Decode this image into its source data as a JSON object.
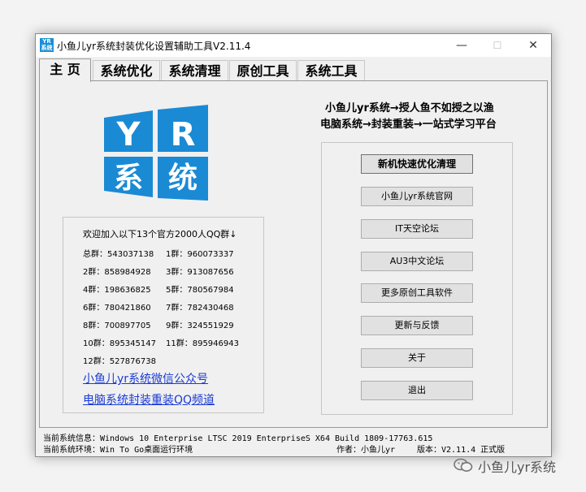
{
  "window": {
    "title": "小鱼儿yr系统封装优化设置辅助工具V2.11.4",
    "icon_text": "YR系统",
    "controls": {
      "minimize": "—",
      "maximize": "☐",
      "close": "✕"
    }
  },
  "tabs": [
    {
      "label": "主 页",
      "active": true
    },
    {
      "label": "系统优化",
      "active": false
    },
    {
      "label": "系统清理",
      "active": false
    },
    {
      "label": "原创工具",
      "active": false
    },
    {
      "label": "系统工具",
      "active": false
    }
  ],
  "logo": {
    "letters": [
      "Y",
      "R",
      "系",
      "统"
    ],
    "color": "#1a8ad4"
  },
  "slogan": {
    "line1": "小鱼儿yr系统→授人鱼不如授之以渔",
    "line2": "电脑系统→封装重装→一站式学习平台"
  },
  "qq_groups": {
    "title": "欢迎加入以下13个官方2000人QQ群↓",
    "rows": [
      [
        "总群：543037138",
        "1群：960073337"
      ],
      [
        "2群：858984928",
        "3群：913087656"
      ],
      [
        "4群：198636825",
        "5群：780567984"
      ],
      [
        "6群：780421860",
        "7群：782430468"
      ],
      [
        "8群：700897705",
        "9群：324551929"
      ],
      [
        "10群：895345147",
        "11群：895946943"
      ],
      [
        "12群：527876738",
        ""
      ]
    ]
  },
  "links": {
    "wechat": "小鱼儿yr系统微信公众号",
    "qq_channel": "电脑系统封装重装QQ频道"
  },
  "buttons": [
    {
      "label": "新机快速优化清理",
      "primary": true
    },
    {
      "label": "小鱼儿yr系统官网",
      "primary": false
    },
    {
      "label": "IT天空论坛",
      "primary": false
    },
    {
      "label": "AU3中文论坛",
      "primary": false
    },
    {
      "label": "更多原创工具软件",
      "primary": false
    },
    {
      "label": "更新与反馈",
      "primary": false
    },
    {
      "label": "关于",
      "primary": false
    },
    {
      "label": "退出",
      "primary": false
    }
  ],
  "status": {
    "system_info": "当前系统信息：Windows 10 Enterprise LTSC 2019 EnterpriseS X64 Build 1809-17763.615",
    "system_env": "当前系统环境：Win To Go桌面运行环境",
    "author": "作者：小鱼儿yr",
    "version": "版本：V2.11.4 正式版"
  },
  "watermark": {
    "text": "小鱼儿yr系统",
    "icon": "wechat-icon"
  }
}
